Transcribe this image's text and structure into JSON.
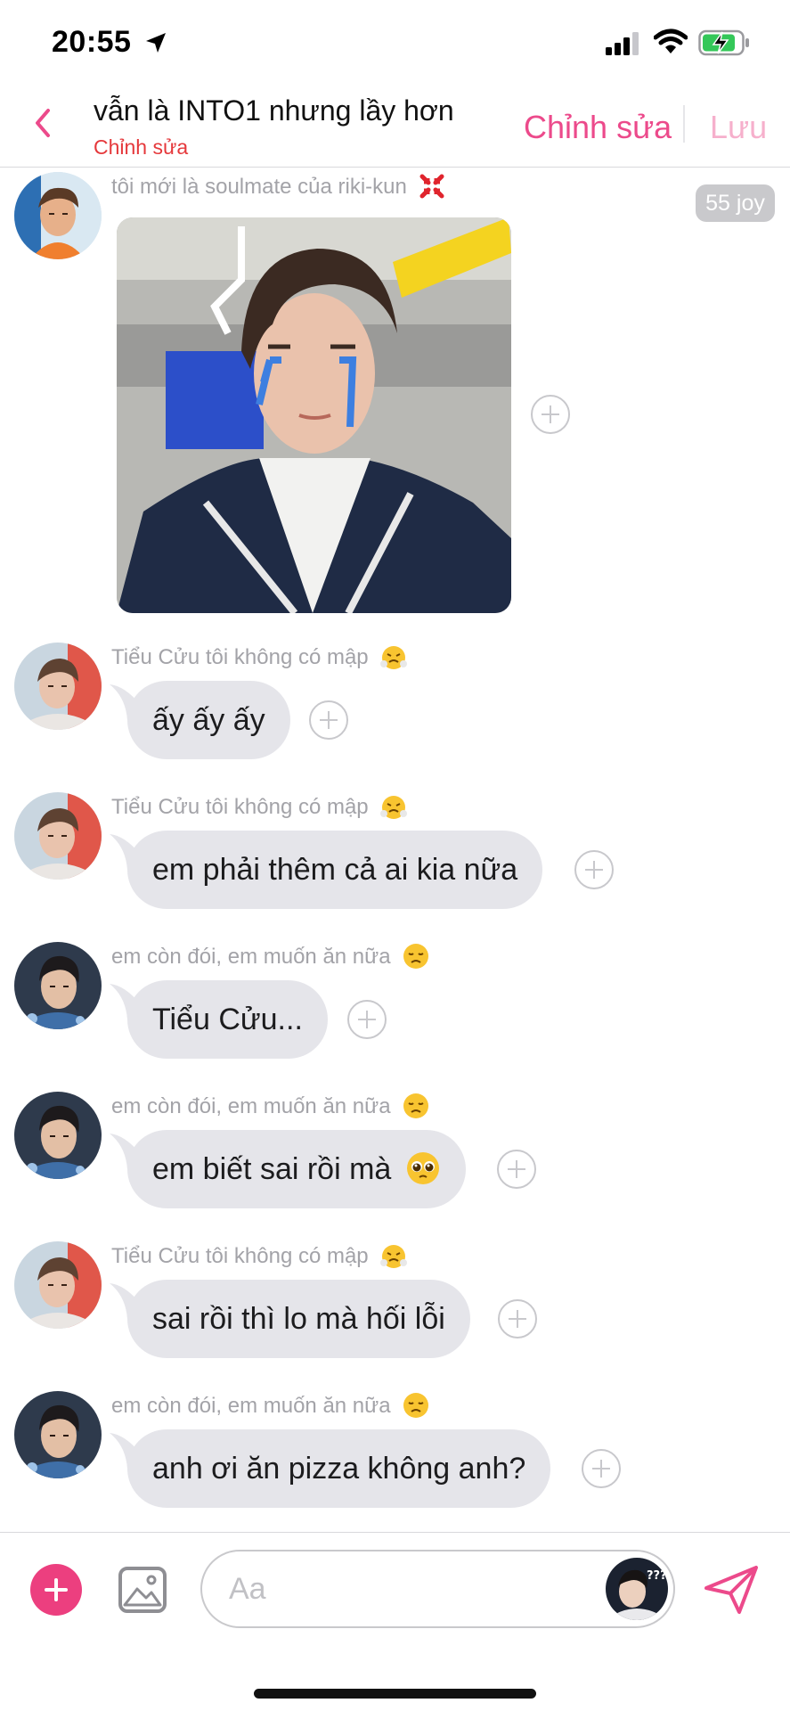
{
  "status_bar": {
    "time": "20:55",
    "icons": [
      "location-arrow-icon",
      "cellular-signal-icon",
      "wifi-icon",
      "battery-charging-icon"
    ]
  },
  "header": {
    "title": "vẫn là INTO1 nhưng lầy hơn",
    "subtitle": "Chỉnh sửa",
    "edit_label": "Chỉnh sửa",
    "save_label": "Lưu",
    "accent_color": "#ec4a8b",
    "subtitle_color": "#e5383b"
  },
  "messages": [
    {
      "sender": "tôi mới là soulmate của riki-kun",
      "sender_emoji": "anger-symbol-icon",
      "type": "image",
      "badge": "55 joy"
    },
    {
      "sender": "Tiểu Cửu tôi không có mập",
      "sender_emoji": "face-with-steam-icon",
      "type": "text",
      "text": "ấy ấy ấy"
    },
    {
      "sender": "Tiểu Cửu tôi không có mập",
      "sender_emoji": "face-with-steam-icon",
      "type": "text",
      "text": "em phải thêm cả ai kia nữa"
    },
    {
      "sender": "em còn đói, em muốn ăn nữa",
      "sender_emoji": "disappointed-face-icon",
      "type": "text",
      "text": "Tiểu Cửu..."
    },
    {
      "sender": "em còn đói, em muốn ăn nữa",
      "sender_emoji": "disappointed-face-icon",
      "type": "text",
      "text": "em biết sai rồi mà",
      "text_emoji": "pleading-face-icon"
    },
    {
      "sender": "Tiểu Cửu tôi không có mập",
      "sender_emoji": "face-with-steam-icon",
      "type": "text",
      "text": "sai rồi thì lo mà hối lỗi"
    },
    {
      "sender": "em còn đói, em muốn ăn nữa",
      "sender_emoji": "disappointed-face-icon",
      "type": "text",
      "text": "anh ơi ăn pizza không anh?"
    }
  ],
  "composer": {
    "placeholder": "Aa",
    "avatar_badge": "???",
    "add_color": "#ec3f7f",
    "send_color": "#ec4a8b"
  }
}
